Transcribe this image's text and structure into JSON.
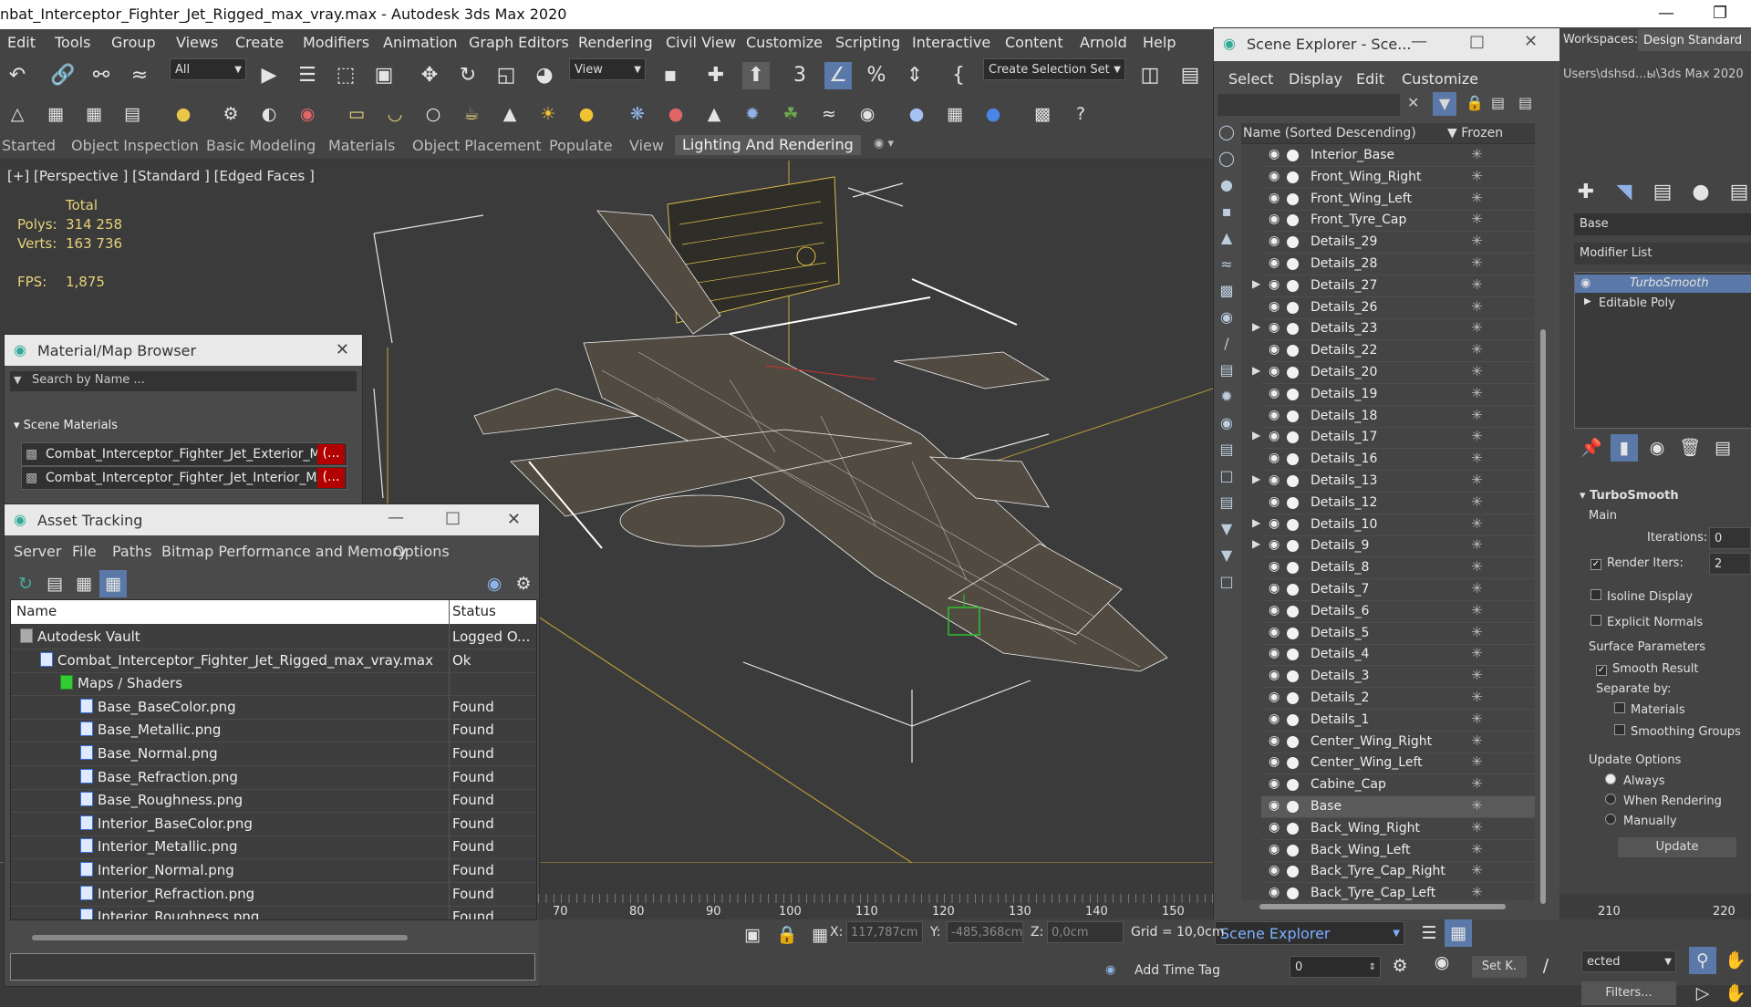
{
  "window": {
    "title": "nbat_Interceptor_Fighter_Jet_Rigged_max_vray.max - Autodesk 3ds Max 2020"
  },
  "menu": [
    "Edit",
    "Tools",
    "Group",
    "Views",
    "Create",
    "Modifiers",
    "Animation",
    "Graph Editors",
    "Rendering",
    "Civil View",
    "Customize",
    "Scripting",
    "Interactive",
    "Content",
    "Arnold",
    "Help"
  ],
  "toolbar": {
    "selection_filter": "All",
    "ref_coord": "View",
    "selection_set": "Create Selection Set"
  },
  "ribbon_tabs": [
    "Started",
    "Object Inspection",
    "Basic Modeling",
    "Materials",
    "Object Placement",
    "Populate",
    "View",
    "Lighting And Rendering"
  ],
  "ribbon_active": "Lighting And Rendering",
  "viewport": {
    "label": "[+] [Perspective ] [Standard ] [Edged Faces ]",
    "stats": {
      "total": "Total",
      "polys_label": "Polys:",
      "polys": "314 258",
      "verts_label": "Verts:",
      "verts": "163 736",
      "fps_label": "FPS:",
      "fps": "1,875"
    }
  },
  "material_browser": {
    "title": "Material/Map Browser",
    "search_placeholder": "Search by Name ...",
    "section": "Scene Materials",
    "materials": [
      {
        "name": "Combat_Interceptor_Fighter_Jet_Exterior_Mat",
        "badge": "(..."
      },
      {
        "name": "Combat_Interceptor_Fighter_Jet_Interior_MAT",
        "badge": "(..."
      }
    ]
  },
  "asset_tracking": {
    "title": "Asset Tracking",
    "menus": [
      "Server",
      "File",
      "Paths",
      "Bitmap Performance and Memory",
      "Options"
    ],
    "columns": {
      "name": "Name",
      "status": "Status"
    },
    "rows": [
      {
        "name": "Autodesk Vault",
        "status": "Logged O...",
        "indent": 0
      },
      {
        "name": "Combat_Interceptor_Fighter_Jet_Rigged_max_vray.max",
        "status": "Ok",
        "indent": 1
      },
      {
        "name": "Maps / Shaders",
        "status": "",
        "indent": 2
      },
      {
        "name": "Base_BaseColor.png",
        "status": "Found",
        "indent": 3
      },
      {
        "name": "Base_Metallic.png",
        "status": "Found",
        "indent": 3
      },
      {
        "name": "Base_Normal.png",
        "status": "Found",
        "indent": 3
      },
      {
        "name": "Base_Refraction.png",
        "status": "Found",
        "indent": 3
      },
      {
        "name": "Base_Roughness.png",
        "status": "Found",
        "indent": 3
      },
      {
        "name": "Interior_BaseColor.png",
        "status": "Found",
        "indent": 3
      },
      {
        "name": "Interior_Metallic.png",
        "status": "Found",
        "indent": 3
      },
      {
        "name": "Interior_Normal.png",
        "status": "Found",
        "indent": 3
      },
      {
        "name": "Interior_Refraction.png",
        "status": "Found",
        "indent": 3
      },
      {
        "name": "Interior_Roughness.png",
        "status": "Found",
        "indent": 3
      }
    ]
  },
  "scene_explorer": {
    "title": "Scene Explorer - Sce...",
    "menus": [
      "Select",
      "Display",
      "Edit",
      "Customize"
    ],
    "col_name": "Name (Sorted Descending)",
    "col_frozen": "Frozen",
    "items": [
      {
        "name": "Interior_Base",
        "expand": false,
        "selected": false
      },
      {
        "name": "Front_Wing_Right",
        "expand": false,
        "selected": false
      },
      {
        "name": "Front_Wing_Left",
        "expand": false,
        "selected": false
      },
      {
        "name": "Front_Tyre_Cap",
        "expand": false,
        "selected": false
      },
      {
        "name": "Details_29",
        "expand": false,
        "selected": false
      },
      {
        "name": "Details_28",
        "expand": false,
        "selected": false
      },
      {
        "name": "Details_27",
        "expand": true,
        "selected": false
      },
      {
        "name": "Details_26",
        "expand": false,
        "selected": false
      },
      {
        "name": "Details_23",
        "expand": true,
        "selected": false
      },
      {
        "name": "Details_22",
        "expand": false,
        "selected": false
      },
      {
        "name": "Details_20",
        "expand": true,
        "selected": false
      },
      {
        "name": "Details_19",
        "expand": false,
        "selected": false
      },
      {
        "name": "Details_18",
        "expand": false,
        "selected": false
      },
      {
        "name": "Details_17",
        "expand": true,
        "selected": false
      },
      {
        "name": "Details_16",
        "expand": false,
        "selected": false
      },
      {
        "name": "Details_13",
        "expand": true,
        "selected": false
      },
      {
        "name": "Details_12",
        "expand": false,
        "selected": false
      },
      {
        "name": "Details_10",
        "expand": true,
        "selected": false
      },
      {
        "name": "Details_9",
        "expand": true,
        "selected": false
      },
      {
        "name": "Details_8",
        "expand": false,
        "selected": false
      },
      {
        "name": "Details_7",
        "expand": false,
        "selected": false
      },
      {
        "name": "Details_6",
        "expand": false,
        "selected": false
      },
      {
        "name": "Details_5",
        "expand": false,
        "selected": false
      },
      {
        "name": "Details_4",
        "expand": false,
        "selected": false
      },
      {
        "name": "Details_3",
        "expand": false,
        "selected": false
      },
      {
        "name": "Details_2",
        "expand": false,
        "selected": false
      },
      {
        "name": "Details_1",
        "expand": false,
        "selected": false
      },
      {
        "name": "Center_Wing_Right",
        "expand": false,
        "selected": false
      },
      {
        "name": "Center_Wing_Left",
        "expand": false,
        "selected": false
      },
      {
        "name": "Cabine_Cap",
        "expand": false,
        "selected": false
      },
      {
        "name": "Base",
        "expand": false,
        "selected": true
      },
      {
        "name": "Back_Wing_Right",
        "expand": false,
        "selected": false
      },
      {
        "name": "Back_Wing_Left",
        "expand": false,
        "selected": false
      },
      {
        "name": "Back_Tyre_Cap_Right",
        "expand": false,
        "selected": false
      },
      {
        "name": "Back_Tyre_Cap_Left",
        "expand": false,
        "selected": false
      }
    ],
    "footer_dropdown": "Scene Explorer"
  },
  "command_panel": {
    "workspaces_label": "Workspaces:",
    "workspace": "Design Standard",
    "path": "Users\\dshsd...ы\\3ds Max 2020",
    "object_name": "Base",
    "modifier_list": "Modifier List",
    "stack": [
      "TurboSmooth",
      "Editable Poly"
    ],
    "rollout": "TurboSmooth",
    "main_label": "Main",
    "iterations_label": "Iterations:",
    "iterations": "0",
    "render_iters_label": "Render Iters:",
    "render_iters": "2",
    "isoline": "Isoline Display",
    "explicit_normals": "Explicit Normals",
    "surface_params": "Surface Parameters",
    "smooth_result": "Smooth Result",
    "separate_by": "Separate by:",
    "materials": "Materials",
    "smoothing_groups": "Smoothing Groups",
    "update_options": "Update Options",
    "always": "Always",
    "when_rendering": "When Rendering",
    "manually": "Manually",
    "update_button": "Update",
    "selected_dd": "ected",
    "filters": "Filters..."
  },
  "status": {
    "x_label": "X:",
    "x": "117,787cm",
    "y_label": "Y:",
    "y": "-485,368cm",
    "z_label": "Z:",
    "z": "0,0cm",
    "grid": "Grid = 10,0cm",
    "add_time_tag": "Add Time Tag",
    "frame": "0",
    "set_key": "Set K."
  },
  "timeline": {
    "ticks": [
      "70",
      "80",
      "90",
      "100",
      "110",
      "120",
      "130",
      "140",
      "150",
      "210",
      "220"
    ]
  }
}
